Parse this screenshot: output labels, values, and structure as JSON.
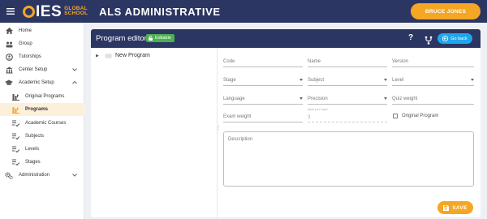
{
  "header": {
    "logo_main": "IES",
    "logo_sub_1": "GLOBAL",
    "logo_sub_2": "SCHOOL",
    "app_title": "ALS ADMINISTRATIVE",
    "user_name": "BRUCE JONES",
    "accent_color": "#f5a623",
    "bar_color": "#2c3663"
  },
  "sidebar": {
    "items": [
      {
        "label": "Home",
        "icon": "home-icon"
      },
      {
        "label": "Group",
        "icon": "group-icon"
      },
      {
        "label": "Tutorships",
        "icon": "tutorship-icon"
      },
      {
        "label": "Center Setup",
        "icon": "school-icon",
        "expandable": true
      },
      {
        "label": "Academic Setup",
        "icon": "mortarboard-icon",
        "expanded": true
      },
      {
        "label": "Original Programs",
        "icon": "programs-icon",
        "sub": true
      },
      {
        "label": "Programs",
        "icon": "programs-icon",
        "sub": true,
        "active": true
      },
      {
        "label": "Academic Courses",
        "icon": "list-check-icon",
        "sub": true
      },
      {
        "label": "Subjects",
        "icon": "list-check-icon",
        "sub": true
      },
      {
        "label": "Levels",
        "icon": "list-check-icon",
        "sub": true
      },
      {
        "label": "Stages",
        "icon": "list-check-icon",
        "sub": true
      },
      {
        "label": "Administration",
        "icon": "gears-icon",
        "expandable": true
      }
    ]
  },
  "editor": {
    "title": "Program editor",
    "badge": "Editable",
    "help_label": "?",
    "back_label": "Go back",
    "tree_node": "New Program",
    "fields": {
      "code": "Code",
      "name": "Name",
      "version": "Version",
      "stage": "Stage",
      "subject": "Subject",
      "level": "Level",
      "language": "Language",
      "precision": "Precision",
      "quiz_weight": "Quiz weight",
      "exam_weight": "Exam weight",
      "quiz_per_topic_label": "Quiz per topic",
      "quiz_per_topic_value": "3",
      "original_program": "Original Program",
      "description": "Description"
    },
    "save_label": "SAVE"
  }
}
